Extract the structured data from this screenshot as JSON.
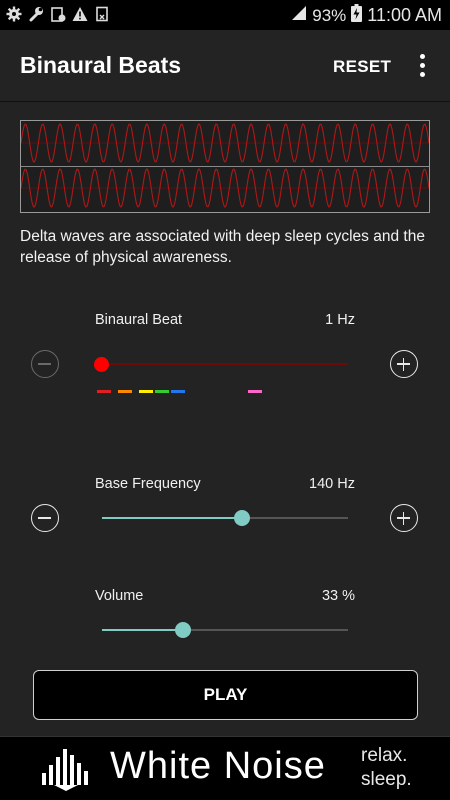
{
  "status_bar": {
    "battery": "93%",
    "time": "11:00 AM",
    "icons": [
      "gear-icon",
      "wrench-icon",
      "clipboard-icon",
      "warning-icon",
      "file-icon",
      "signal-icon",
      "battery-charging-icon"
    ]
  },
  "app_bar": {
    "title": "Binaural Beats",
    "reset_label": "RESET",
    "overflow_icon": "more-vert-icon"
  },
  "waveform": {
    "channels": 2,
    "color": "#b01818"
  },
  "description": "Delta waves are associated with deep sleep cycles and the release of physical awareness.",
  "controls": {
    "binaural_beat": {
      "label": "Binaural Beat",
      "value": "1 Hz",
      "level": 0.0,
      "color": "#ff0000",
      "band_markers": [
        "#e02020",
        "#ff8800",
        "#ffee00",
        "#33cc33",
        "#2277ee",
        "#ff66cc"
      ]
    },
    "base_frequency": {
      "label": "Base Frequency",
      "value": "140 Hz",
      "level": 0.57
    },
    "volume": {
      "label": "Volume",
      "value": "33 %",
      "level": 0.33
    }
  },
  "play_label": "PLAY",
  "ad_banner": {
    "title": "White Noise",
    "tagline_line1": "relax.",
    "tagline_line2": "sleep."
  },
  "colors": {
    "accent": "#80cbc4",
    "background": "#232323"
  }
}
